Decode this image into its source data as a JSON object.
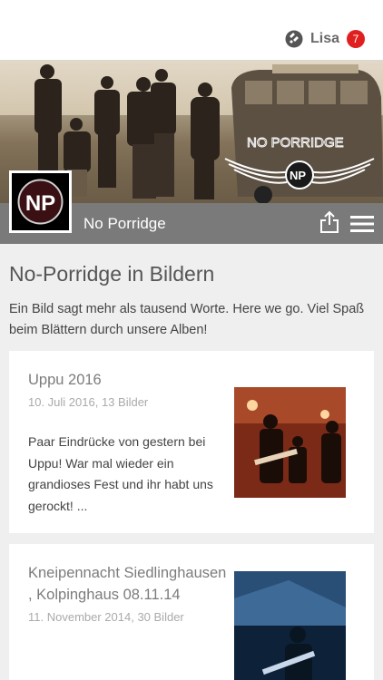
{
  "topbar": {
    "user_name": "Lisa",
    "badge_count": "7",
    "user_icon": "user-logo-icon"
  },
  "hero": {
    "band_logo_text": "NO PORRIDGE",
    "logo_letters": "NP"
  },
  "titlebar": {
    "band_name": "No Porridge",
    "share_icon": "share-icon",
    "menu_icon": "hamburger-menu-icon"
  },
  "page": {
    "title": "No-Porridge in Bildern",
    "intro": "Ein Bild sagt mehr als tausend Worte. Here we go. Viel Spaß beim Blättern durch unsere Alben!"
  },
  "albums": [
    {
      "title": "Uppu 2016",
      "meta": "10. Juli 2016, 13 Bilder",
      "description": "Paar Eindrücke von gestern bei Uppu! War mal wieder ein grandioses Fest und ihr habt uns gerockt! ..."
    },
    {
      "title": "Kneipennacht Siedlinghausen , Kolpinghaus 08.11.14",
      "meta": "11. November 2014, 30 Bilder"
    }
  ],
  "colors": {
    "badge": "#e0201f",
    "titlebar": "#7a7a7a",
    "background": "#efefef"
  }
}
